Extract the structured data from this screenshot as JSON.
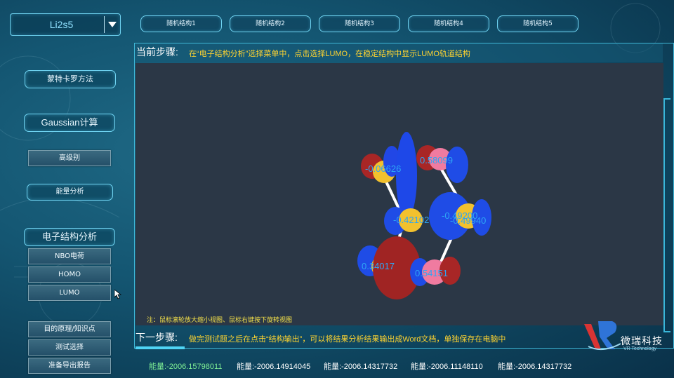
{
  "molecule_select": {
    "value": "Li2s5"
  },
  "structure_tabs": [
    "随机结构1",
    "随机结构2",
    "随机结构3",
    "随机结构4",
    "随机结构5"
  ],
  "sidebar": {
    "monte_carlo": "蒙特卡罗方法",
    "gaussian": "Gaussian计算",
    "advanced": "高级别",
    "energy_analysis": "能量分析",
    "electronic_structure": "电子结构分析",
    "nbo": "NBO电荷",
    "homo": "HOMO",
    "lumo": "LUMO",
    "objectives": "目的原理/知识点",
    "quiz": "测试选择",
    "export_report": "准备导出报告"
  },
  "current_step": {
    "label": "当前步骤:",
    "text": "在“电子结构分析”选择菜单中，点击选择LUMO，在稳定结构中显示LUMO轨道结构"
  },
  "viewport": {
    "note": "注：鼠标滚轮放大缩小视图、鼠标右键按下旋转视图",
    "atom_labels": [
      "-0.06626",
      "0.58099",
      "-0.42102",
      "-0.49200",
      "-0.49940",
      "0.34017",
      "0.54151"
    ]
  },
  "next_step": {
    "label": "下一步骤:",
    "text": "做完测试题之后在点击“结构输出”，可以将结果分析结果输出成Word文档，单独保存在电脑中"
  },
  "energies": [
    "能量:-2006.15798011",
    "能量:-2006.14914045",
    "能量:-2006.14317732",
    "能量:-2006.11148110",
    "能量:-2006.14317732"
  ],
  "logo": {
    "name_cn": "微瑞科技",
    "name_en": "VR Technology"
  },
  "colors": {
    "accent": "#6fd3f1",
    "step_text": "#ffd430",
    "energy_active": "#7ff095",
    "orbital_blue": "#1f4fe6",
    "orbital_red": "#b32a27",
    "atom_yellow": "#f4c233",
    "atom_pink": "#f07ba0"
  }
}
